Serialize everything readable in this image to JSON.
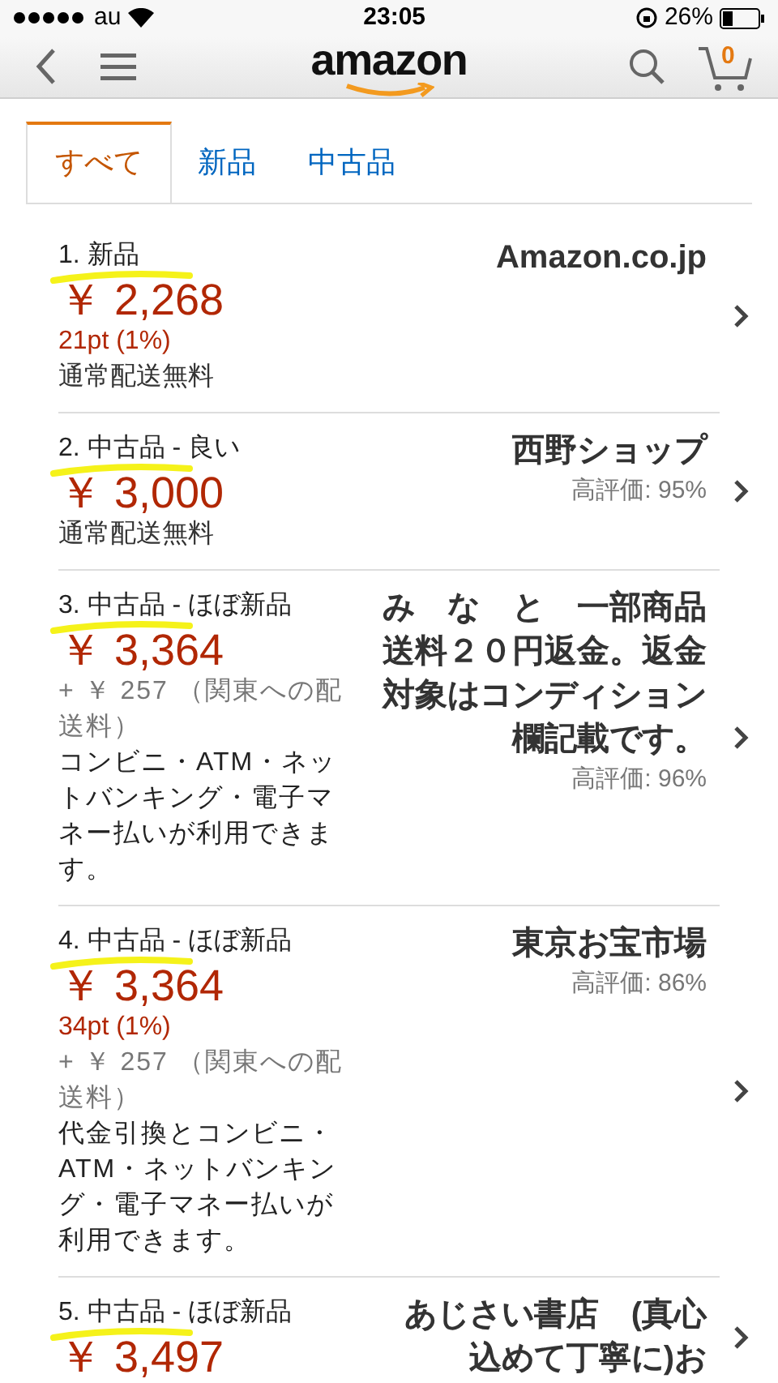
{
  "status_bar": {
    "carrier": "au",
    "time": "23:05",
    "battery": "26%"
  },
  "header": {
    "logo": "amazon",
    "cart_count": "0"
  },
  "tabs": [
    {
      "label": "すべて",
      "selected": true
    },
    {
      "label": "新品",
      "selected": false
    },
    {
      "label": "中古品",
      "selected": false
    }
  ],
  "offers": [
    {
      "condition": "1. 新品",
      "marked": true,
      "price": "￥ 2,268",
      "points": "21pt (1%)",
      "shipping": "通常配送無料",
      "seller": "Amazon.co.jp"
    },
    {
      "condition": "2. 中古品 - 良い",
      "marked": true,
      "price": "￥ 3,000",
      "shipping": "通常配送無料",
      "seller": "西野ショップ",
      "rating": "高評価: 95%"
    },
    {
      "condition": "3. 中古品 - ほぼ新品",
      "marked": true,
      "price": "￥ 3,364",
      "delivery_fee": "+ ￥ 257 （関東への配送料）",
      "payment": "コンビニ・ATM・ネットバンキング・電子マネー払いが利用できます。",
      "seller": "み　な　と　一部商品送料２０円返金。返金対象はコンディション欄記載です。",
      "rating": "高評価: 96%"
    },
    {
      "condition": "4. 中古品 - ほぼ新品",
      "marked": true,
      "price": "￥ 3,364",
      "points": "34pt (1%)",
      "delivery_fee": "+ ￥ 257 （関東への配送料）",
      "payment": "代金引換とコンビニ・ATM・ネットバンキング・電子マネー払いが利用できます。",
      "seller": "東京お宝市場",
      "rating": "高評価: 86%"
    },
    {
      "condition": "5. 中古品 - ほぼ新品",
      "marked": true,
      "price": "￥ 3,497",
      "seller": "あじさい書店　(真心込めて丁寧に)お"
    }
  ]
}
